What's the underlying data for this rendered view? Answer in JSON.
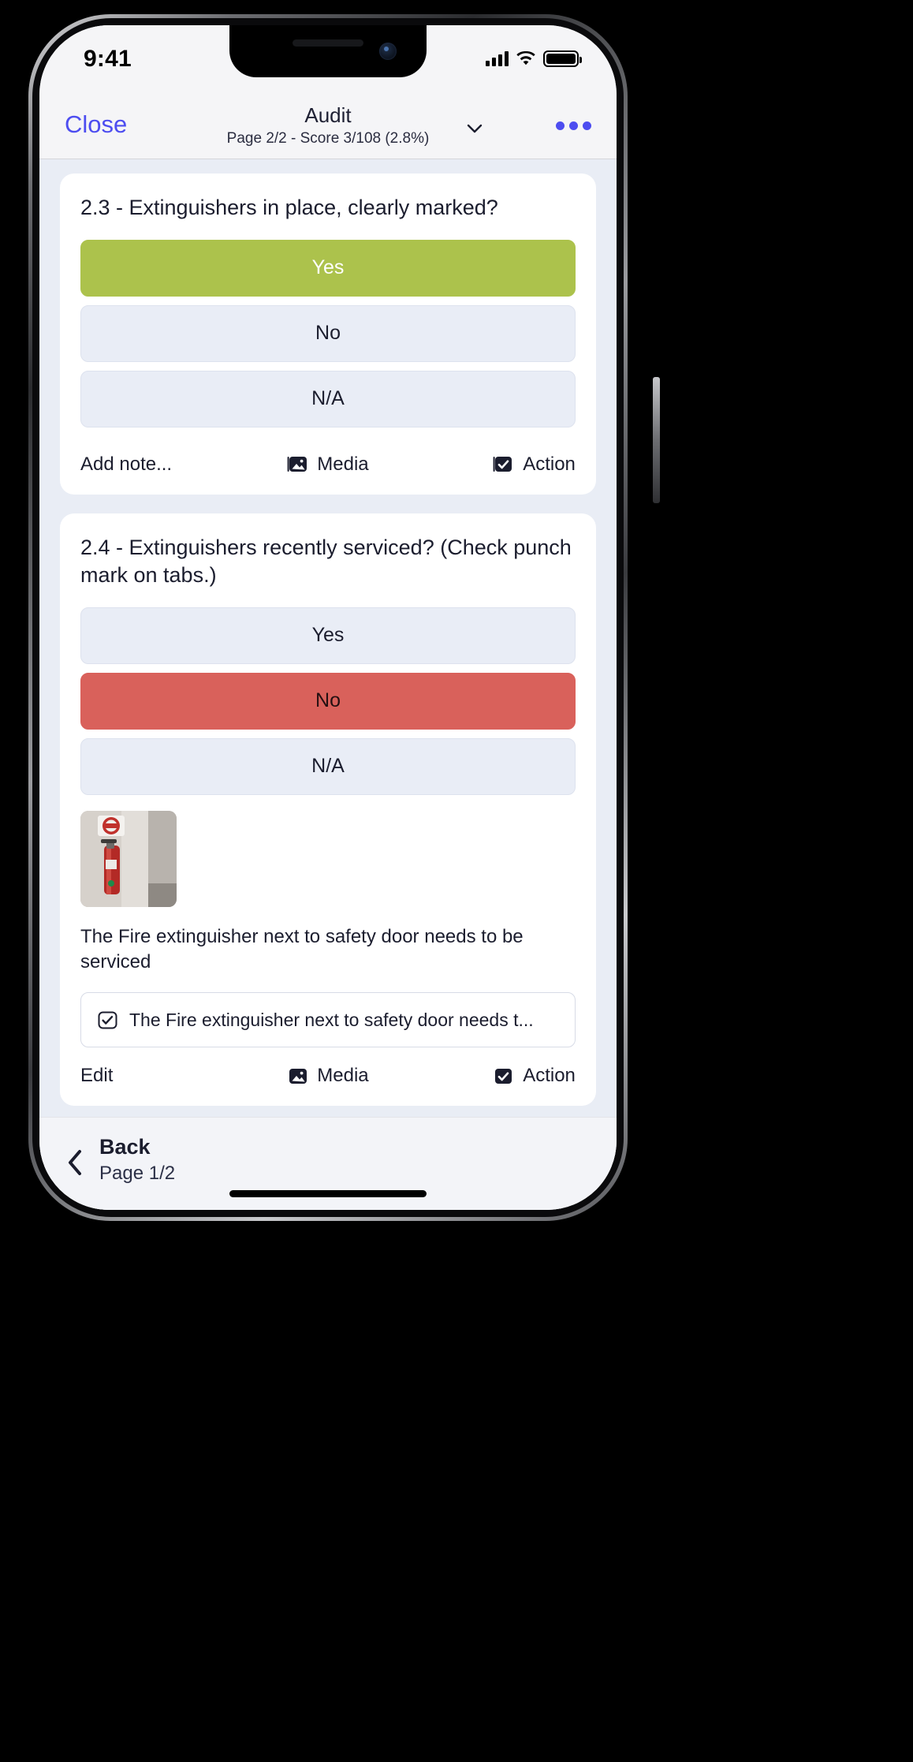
{
  "status_bar": {
    "time": "9:41",
    "signal_icon": "cellular-bars-icon",
    "wifi_icon": "wifi-icon",
    "battery_icon": "battery-full-icon"
  },
  "nav_bar": {
    "close_label": "Close",
    "title": "Audit",
    "subtitle": "Page 2/2 - Score 3/108 (2.8%)",
    "chevron_icon": "chevron-down-icon",
    "more_icon": "ellipsis-icon",
    "close_color": "#4d4df0",
    "more_color": "#4d4df0"
  },
  "theme": {
    "background": "#e9edf5",
    "card": "#ffffff",
    "option_unselected": "#e9edf6",
    "yes_selected": "#acc24c",
    "no_selected": "#d9615b",
    "text": "#1b1d2e"
  },
  "questions": [
    {
      "title": "2.3 - Extinguishers in place, clearly marked?",
      "options": [
        {
          "label": "Yes",
          "state": "selected-yes"
        },
        {
          "label": "No",
          "state": "unselected"
        },
        {
          "label": "N/A",
          "state": "unselected"
        }
      ],
      "toolbar": [
        {
          "label": "Add note...",
          "icon": "none"
        },
        {
          "label": "Media",
          "icon": "media-image-icon"
        },
        {
          "label": "Action",
          "icon": "checkbox-checked-icon"
        }
      ]
    },
    {
      "title": "2.4 - Extinguishers recently serviced? (Check punch mark on tabs.)",
      "options": [
        {
          "label": "Yes",
          "state": "unselected"
        },
        {
          "label": "No",
          "state": "selected-no"
        },
        {
          "label": "N/A",
          "state": "unselected"
        }
      ],
      "media_thumbnail": "fire-extinguisher-photo",
      "note": "The Fire extinguisher next to safety door needs to be serviced",
      "action_chip": {
        "icon": "checkbox-checked-icon",
        "label": "The Fire extinguisher next to safety door needs t..."
      },
      "toolbar": [
        {
          "label": "Edit",
          "icon": "none"
        },
        {
          "label": "Media",
          "icon": "media-image-icon"
        },
        {
          "label": "Action",
          "icon": "checkbox-checked-icon"
        }
      ]
    }
  ],
  "bottom_bar": {
    "back_icon": "chevron-left-icon",
    "back_label": "Back",
    "back_sub": "Page 1/2"
  }
}
